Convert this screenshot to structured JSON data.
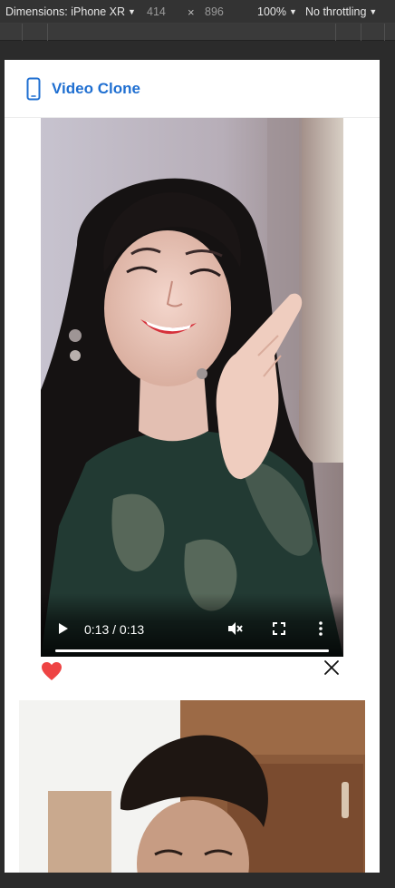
{
  "devtools": {
    "dimensions_label": "Dimensions: iPhone XR",
    "width": "414",
    "times": "×",
    "height": "896",
    "zoom": "100%",
    "throttling": "No throttling"
  },
  "app": {
    "title": "Video Clone",
    "brand_color": "#1f6fd1"
  },
  "video1": {
    "time": "0:13 / 0:13",
    "progress": 1.0,
    "muted": true
  },
  "actions": {
    "heart_color": "#ee4444",
    "liked": true
  }
}
